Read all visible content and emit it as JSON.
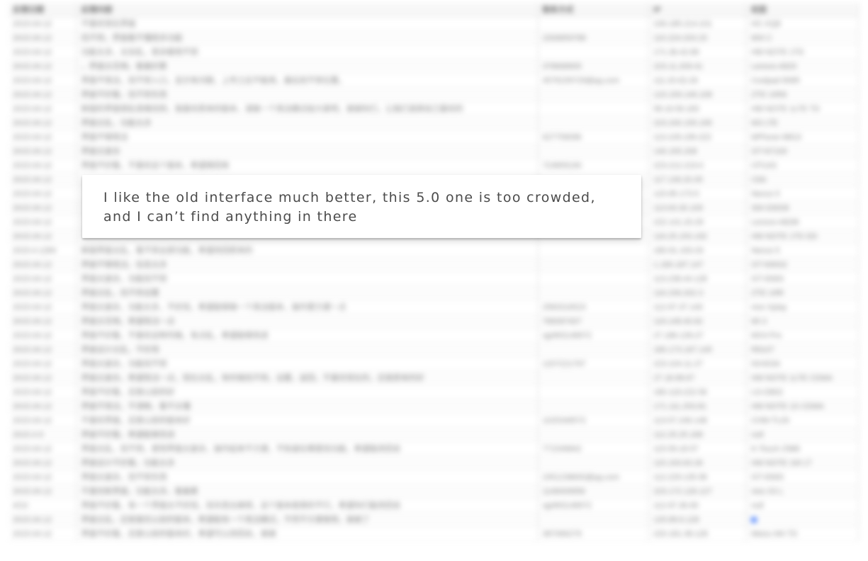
{
  "window": {
    "title": ""
  },
  "spreadsheet": {
    "blurred": true,
    "columns": [
      {
        "key": "date",
        "label": "反馈日期"
      },
      {
        "key": "feedback",
        "label": "反馈内容"
      },
      {
        "key": "contact",
        "label": "联系方式"
      },
      {
        "key": "ip",
        "label": "IP"
      },
      {
        "key": "device",
        "label": "机型"
      }
    ],
    "rows": [
      {
        "date": "2015.04.12",
        "feedback": "不喜欢现在界面",
        "contact": "",
        "ip": "106.185.214.101",
        "device": "HC-XQ8"
      },
      {
        "date": "2015.04.12",
        "feedback": "找不到，界面看不懂很多功能",
        "contact": "2306859788",
        "ip": "110.224.203.23",
        "device": "MI4 C"
      },
      {
        "date": "2015.04.12",
        "feedback": "功能太多，太杂乱，很多都用不到",
        "contact": "",
        "ip": "171.36.42.89",
        "device": "HM NOTE 1TD"
      },
      {
        "date": "2015.04.12",
        "feedback": "，界面太花哨，看着好累",
        "contact": "378668905",
        "ip": "223.11.209.41",
        "device": "Lenovo A820"
      },
      {
        "date": "2015.04.12",
        "feedback": "界面不简洁，找不到入口，显示有问题，上传之后不能用，最后找不到位置。",
        "contact": "4578159729@qq.com",
        "ip": "111.20.62.26",
        "device": "Coolpad 8085"
      },
      {
        "date": "2015.04.12",
        "feedback": "界面不好看，找不到东西",
        "contact": "",
        "ip": "123.159.146.108",
        "device": "ZTE U956"
      },
      {
        "date": "2015.04.12",
        "feedback": "新版的界面很乱很难找到，我喜欢原来的版本，请做一个简洁模式给大家吧，谢谢你们，让我们选择自己喜欢的",
        "contact": "",
        "ip": "58.16.56.183",
        "device": "HM NOTE 1LTE TD"
      },
      {
        "date": "2015.04.12",
        "feedback": "界面太乱，功能太多",
        "contact": "",
        "ip": "223.240.155.195",
        "device": "M3 LTE"
      },
      {
        "date": "2015.04.12",
        "feedback": "界面不够简洁",
        "contact": "627759096",
        "ip": "113.109.199.222",
        "device": "ktPhone M810"
      },
      {
        "date": "2015.04.12",
        "feedback": "界面太复杂",
        "contact": "",
        "ip": "140.155.208",
        "device": "GT-N7100"
      },
      {
        "date": "2015.04.12",
        "feedback": "界面不好看，不喜欢这个版本，希望换回来",
        "contact": "724859190",
        "ip": "223.212.219.0",
        "device": "CP1AS"
      },
      {
        "date": "2015.04.12",
        "feedback": "",
        "contact": "",
        "ip": "117.136.20.05",
        "device": "C8A"
      },
      {
        "date": "2015.04.12",
        "feedback": "",
        "contact": "",
        "ip": "120.85.173.5",
        "device": "Nexus 5"
      },
      {
        "date": "2015.04.12",
        "feedback": "",
        "contact": "",
        "ip": "113.63.30.109",
        "device": "SM-G9008"
      },
      {
        "date": "2015.04.12",
        "feedback": "",
        "contact": "",
        "ip": "222.141.20.29",
        "device": "Lenovo A828t"
      },
      {
        "date": "2015.04.12",
        "feedback": "",
        "contact": "",
        "ip": "116.25.153.192",
        "device": "HM NOTE 1TD DD"
      },
      {
        "date": "2015.4.1284",
        "feedback": "新版界面太乱，看不到全部功能，希望改回原来的",
        "contact": "",
        "ip": "180.91.193.33",
        "device": "Nexus 5"
      },
      {
        "date": "2015.04.12",
        "feedback": "界面不够简洁，信息太多",
        "contact": "",
        "ip": "1.180.187.147",
        "device": "GT-N9002"
      },
      {
        "date": "2015.04.12",
        "feedback": "界面太复杂，功能找不到",
        "contact": "",
        "ip": "113.238.44.128",
        "device": "GT-I9300"
      },
      {
        "date": "2015.04.12",
        "feedback": "界面太乱，找不到设置",
        "contact": "",
        "ip": "116.236.202.3",
        "device": "ZTE U9R"
      },
      {
        "date": "2015.04.12",
        "feedback": "界面太复杂，功能太多，不好找，希望能够做一个简洁版本，操作更方便一点",
        "contact": "2583316523",
        "ip": "112.97.37.140",
        "device": "vivo Xplay"
      },
      {
        "date": "2015.04.12",
        "feedback": "界面太花哨，希望简洁一点",
        "contact": "768397407",
        "ip": "119.148.40.62",
        "device": "MI 3"
      },
      {
        "date": "2015.04.12",
        "feedback": "界面不好看，不喜欢这种风格，有点乱，希望能够改进",
        "contact": "xjp993148972",
        "ip": "27.186.139.27",
        "device": "MX4 Pro"
      },
      {
        "date": "2015.04.12",
        "feedback": "界面设计太乱，不好用",
        "contact": "",
        "ip": "180.173.167.145",
        "device": "R8107"
      },
      {
        "date": "2015.04.12",
        "feedback": "界面太复杂，功能找不到",
        "contact": "1207221767",
        "ip": "223.104.11.27",
        "device": "NX403A"
      },
      {
        "date": "2015.04.12",
        "feedback": "界面太复杂，希望简洁一点，现在太乱，有时候找不到，设置，返回，不喜欢现在的，还是原来的好",
        "contact": "",
        "ip": "27.18.98.67",
        "device": "HM NOTE 1LTE CDMA"
      },
      {
        "date": "2015.04.12",
        "feedback": "界面不好看，还是以前的好",
        "contact": "",
        "ip": "180.118.222.56",
        "device": "LG-D802"
      },
      {
        "date": "2015.04.12",
        "feedback": "界面不简洁，不清晰，看不太懂",
        "contact": "",
        "ip": "171.111.253.81",
        "device": "HM NOTE 1S CDMA"
      },
      {
        "date": "2015.04.12",
        "feedback": "不喜欢界面，还是以前的版本好",
        "contact": "1025346572",
        "ip": "113.57.246.148",
        "device": "CHM-TL00"
      },
      {
        "date": "2015.4.9",
        "feedback": "界面不好看，希望能够改进",
        "contact": "",
        "ip": "112.25.25.168",
        "device": "null"
      },
      {
        "date": "2015.04.12",
        "feedback": "界面太乱，找不到，感觉界面太复杂，操作起来不方便，不知道在哪里找功能，希望能改回去",
        "contact": "771549842",
        "ip": "115.59.18.57",
        "device": "K-Touch Z988"
      },
      {
        "date": "2015.04.12",
        "feedback": "界面设计不好看，功能太多",
        "contact": "",
        "ip": "115.193.63.26",
        "device": "HM NOTE 1W LT"
      },
      {
        "date": "2015.04.12",
        "feedback": "界面太复杂，找不到东西",
        "contact": "2451238830@qq.com",
        "ip": "112.229.135.58",
        "device": "GT-I9300"
      },
      {
        "date": "2015.04.12",
        "feedback": "不喜欢新界面，功能太多，看着累",
        "contact": "1148409956",
        "ip": "223.172.126.127",
        "device": "vivo X3 L"
      },
      {
        "date": "4/10",
        "feedback": "界面不好看，有一个界面太不好找，找东西太麻烦，这个版本是真的不行，希望你们能改回去",
        "contact": "xjp993148972",
        "ip": "112.97.36.90",
        "device": "null"
      },
      {
        "date": "2015.04.12",
        "feedback": "界面太乱，还是喜欢以前的版本，希望能有一个简洁模式，不然不方便使用，谢谢了",
        "contact": "",
        "ip": "125.89.6.128",
        "device": "",
        "mark": true
      },
      {
        "date": "2015.04.12",
        "feedback": "界面不好看，还是以前的版本好，希望可以改回去，谢谢",
        "contact": "387066279",
        "ip": "220.181.38.128",
        "device": "Meizu M4 TD"
      }
    ]
  },
  "overlay": {
    "quote_text": "I like the old interface much better, this 5.0 one is too crowded, and I can’t find anything in there"
  }
}
